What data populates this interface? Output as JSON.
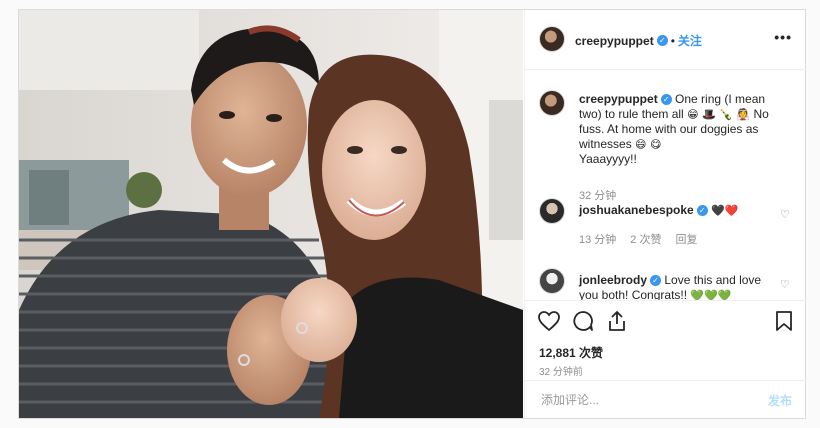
{
  "post": {
    "username": "creepypuppet",
    "follow_label": "关注",
    "more_label": "•••"
  },
  "caption": {
    "username": "creepypuppet",
    "text_line1": "One ring (I mean",
    "text_line2": "two) to rule them all",
    "emojis_a": "😁 🎩 🍾 👰",
    "text_line3": "No",
    "text_line4": "fuss. At home with our doggies as",
    "text_line5": "witnesses",
    "emojis_b": "😄 😋",
    "text_line6": "Yaaayyyy!!",
    "time": "32 分钟"
  },
  "comments": [
    {
      "username": "joshuakanebespoke",
      "text": "🖤❤️",
      "time": "13 分钟",
      "likes": "2 次赞",
      "reply": "回复"
    },
    {
      "username": "jonleebrody",
      "text_line1": "Love this and love",
      "text_line2": "you both! Congrats!!",
      "emojis": "💚💚💚"
    }
  ],
  "stats": {
    "likes": "12,881 次赞",
    "time": "32 分钟前"
  },
  "add_comment": {
    "placeholder": "添加评论...",
    "post_label": "发布"
  },
  "colors": {
    "link_blue": "#3897f0",
    "muted_gray": "#8e8e8e",
    "border": "#efefef",
    "post_btn_disabled": "#b2dffc"
  }
}
